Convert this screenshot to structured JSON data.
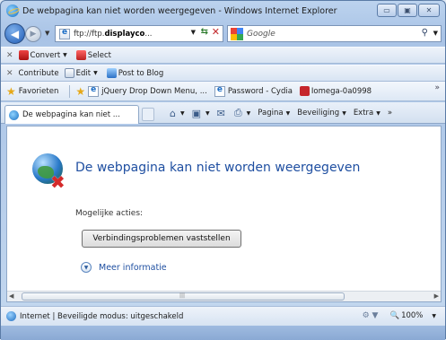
{
  "window": {
    "title": "De webpagina kan niet worden weergegeven - Windows Internet Explorer",
    "controls": {
      "minimize": "▭",
      "maximize": "▣",
      "close": "✕"
    }
  },
  "navigation": {
    "address": {
      "prefix": "ftp://ftp.",
      "bold": "displayco",
      "suffix": "..."
    },
    "search_placeholder": "Google"
  },
  "toolbar1": {
    "items": [
      {
        "label": "Convert"
      },
      {
        "label": "Select"
      }
    ]
  },
  "toolbar2": {
    "items": [
      {
        "label": "Contribute"
      },
      {
        "label": "Edit"
      },
      {
        "label": "Post to Blog"
      }
    ]
  },
  "favorites": {
    "label": "Favorieten",
    "links": [
      {
        "label": "jQuery Drop Down Menu, ..."
      },
      {
        "label": "Password - Cydia"
      },
      {
        "label": "Iomega-0a0998"
      }
    ],
    "more": "»"
  },
  "tabs": [
    {
      "label": "De webpagina kan niet ..."
    }
  ],
  "commandbar": {
    "items": [
      {
        "label": "Pagina"
      },
      {
        "label": "Beveiliging"
      },
      {
        "label": "Extra"
      }
    ],
    "more": "»"
  },
  "page": {
    "heading": "De webpagina kan niet worden weergegeven",
    "actions_label": "Mogelijke acties:",
    "diagnose_button": "Verbindingsproblemen vaststellen",
    "more_info": "Meer informatie"
  },
  "statusbar": {
    "text": "Internet | Beveiligde modus: uitgeschakeld",
    "zoom": "100%"
  }
}
